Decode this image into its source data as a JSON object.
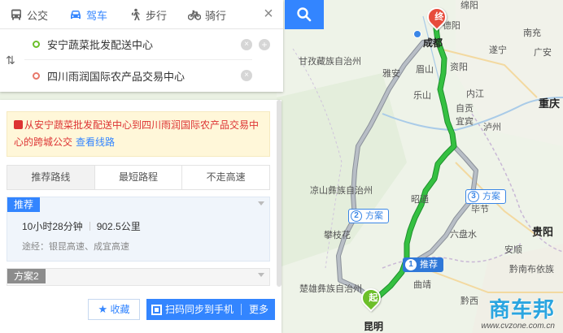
{
  "mode_tabs": [
    {
      "label": "公交",
      "icon": "bus-icon"
    },
    {
      "label": "驾车",
      "icon": "car-icon"
    },
    {
      "label": "步行",
      "icon": "walk-icon"
    },
    {
      "label": "骑行",
      "icon": "bike-icon"
    }
  ],
  "active_mode": "驾车",
  "route": {
    "start": "安宁蔬菜批发配送中心",
    "end": "四川雨润国际农产品交易中心"
  },
  "notice": {
    "text": "从安宁蔬菜批发配送中心到四川雨润国际农产品交易中心的跨城公交",
    "link": "查看线路"
  },
  "strategy_tabs": [
    "推荐路线",
    "最短路程",
    "不走高速"
  ],
  "plans": [
    {
      "label": "推荐",
      "duration": "10小时28分钟",
      "distance": "902.5公里",
      "via": "途经：银昆高速、成宜高速"
    },
    {
      "label": "方案2"
    }
  ],
  "actions": {
    "favorite": "收藏",
    "send": "扫码同步到手机",
    "more": "更多"
  },
  "map": {
    "markers": {
      "end": "终",
      "start": "起"
    },
    "plan_tags": [
      {
        "num": "1",
        "label": "推荐"
      },
      {
        "num": "2",
        "label": "方案"
      },
      {
        "num": "3",
        "label": "方案"
      }
    ],
    "labels": [
      "绵阳",
      "南充",
      "遂宁",
      "广安",
      "成都",
      "德阳",
      "甘孜藏族自治州",
      "雅安",
      "眉山",
      "资阳",
      "乐山",
      "内江",
      "重庆",
      "宜宾",
      "自贡",
      "泸州",
      "凉山彝族自治州",
      "昭通",
      "攀枝花",
      "六盘水",
      "贵阳",
      "毕节",
      "安顺",
      "楚雄彝族自治州",
      "曲靖",
      "黔南布依族",
      "黔西",
      "昆明"
    ],
    "watermark": "商车邦",
    "watermark_url": "www.cvzone.com.cn",
    "colors": {
      "main_route": "#29b33a",
      "alt_route": "#9aa0a6",
      "accent": "#3385ff"
    }
  }
}
